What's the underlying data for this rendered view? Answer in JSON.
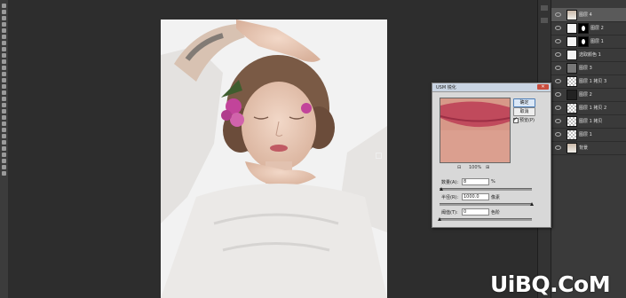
{
  "toolbar": {
    "tool_count": 28
  },
  "canvas": {
    "description_icon": "photo-canvas"
  },
  "layers": [
    {
      "name": "图层 4",
      "thumb": "photo",
      "selected": true
    },
    {
      "name": "图层 2",
      "thumb": "white",
      "mask": true,
      "linked": true
    },
    {
      "name": "图层 1",
      "thumb": "white",
      "mask": true,
      "linked": true
    },
    {
      "name": "选取颜色 1",
      "thumb": "white"
    },
    {
      "name": "图层 3",
      "thumb": "gray"
    },
    {
      "name": "图层 1 拷贝 3",
      "thumb": "check"
    },
    {
      "name": "图层 2",
      "thumb": "dark"
    },
    {
      "name": "图层 1 拷贝 2",
      "thumb": "check"
    },
    {
      "name": "图层 1 拷贝",
      "thumb": "check"
    },
    {
      "name": "图层 1",
      "thumb": "check"
    },
    {
      "name": "背景",
      "thumb": "photo"
    }
  ],
  "dialog": {
    "title": "USM 锐化",
    "ok_label": "确定",
    "cancel_label": "取消",
    "preview_label": "预览(P)",
    "preview_checked": true,
    "zoom_value": "100%",
    "zoom_out_icon": "minus-icon",
    "zoom_in_icon": "plus-icon",
    "amount_label": "数量(A):",
    "amount_value": "8",
    "amount_unit": "%",
    "radius_label": "半径(R):",
    "radius_value": "1000.0",
    "radius_unit": "像素",
    "threshold_label": "阈值(T):",
    "threshold_value": "0",
    "threshold_unit": "色阶",
    "amount_level": 0.02,
    "radius_level": 1.0,
    "threshold_level": 0.0
  },
  "watermark": "UiBQ.CoM"
}
